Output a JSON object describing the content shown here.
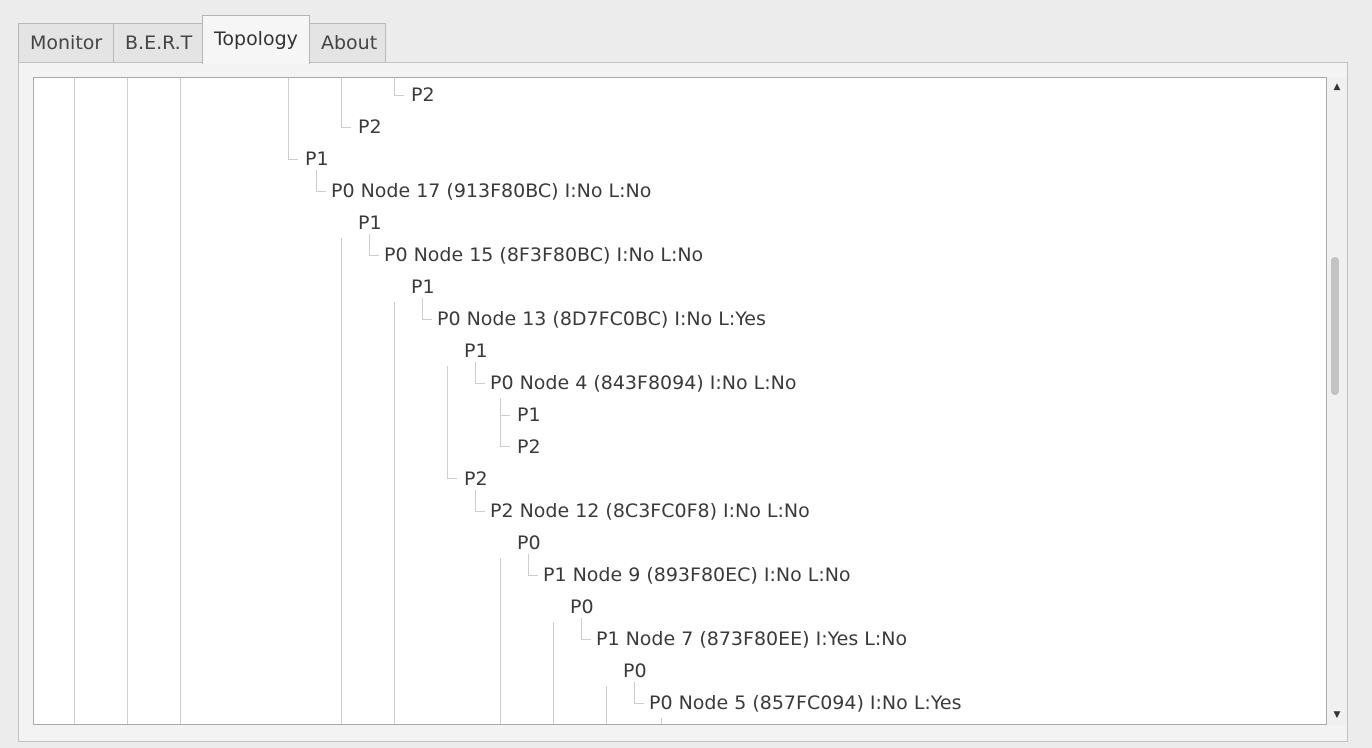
{
  "tabs": [
    {
      "label": "Monitor",
      "active": false
    },
    {
      "label": "B.E.R.T",
      "active": false
    },
    {
      "label": "Topology",
      "active": true
    },
    {
      "label": "About",
      "active": false
    }
  ],
  "tree": {
    "rows": [
      {
        "text": "P2",
        "depth": 1
      },
      {
        "text": "P2",
        "depth": 2
      },
      {
        "text": "P1",
        "depth": 3
      },
      {
        "text": "P0 Node 17 (913F80BC) I:No L:No",
        "depth": 4
      },
      {
        "text": "P1",
        "depth": 5
      },
      {
        "text": "P0 Node 15 (8F3F80BC) I:No L:No",
        "depth": 6
      },
      {
        "text": "P1",
        "depth": 7
      },
      {
        "text": "P0 Node 13 (8D7FC0BC) I:No L:Yes",
        "depth": 8
      },
      {
        "text": "P1",
        "depth": 9
      },
      {
        "text": "P0 Node 4 (843F8094) I:No L:No",
        "depth": 10
      },
      {
        "text": "P1",
        "depth": 11
      },
      {
        "text": "P2",
        "depth": 11
      },
      {
        "text": "P2",
        "depth": 9
      },
      {
        "text": "P2 Node 12 (8C3FC0F8) I:No L:No",
        "depth": 10
      },
      {
        "text": "P0",
        "depth": 11
      },
      {
        "text": "P1 Node 9 (893F80EC) I:No L:No",
        "depth": 12
      },
      {
        "text": "P0",
        "depth": 13
      },
      {
        "text": "P1 Node 7 (873F80EE) I:Yes L:No",
        "depth": 14
      },
      {
        "text": "P0",
        "depth": 15
      },
      {
        "text": "P0 Node 5 (857FC094) I:No L:Yes",
        "depth": 16
      }
    ]
  },
  "scrollbar": {
    "up_icon": "arrow-up-icon",
    "down_icon": "arrow-down-icon",
    "up_glyph": "▲",
    "down_glyph": "▼"
  },
  "colors": {
    "tree_line": "#cdcdcd",
    "window_bg": "#ececec",
    "tree_bg": "#ffffff"
  }
}
